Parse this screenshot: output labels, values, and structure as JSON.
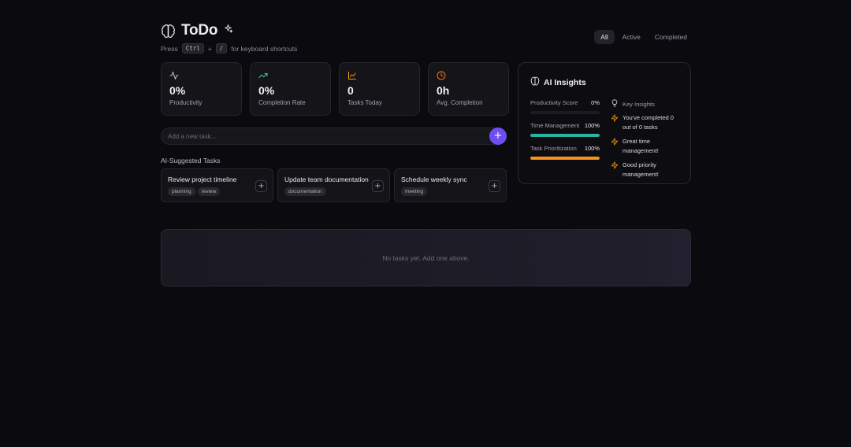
{
  "header": {
    "title": "ToDo",
    "press": "Press",
    "key1": "Ctrl",
    "plus": "+",
    "key2": "/",
    "hint": "for keyboard shortcuts"
  },
  "filters": [
    {
      "label": "All",
      "active": true
    },
    {
      "label": "Active",
      "active": false
    },
    {
      "label": "Completed",
      "active": false
    }
  ],
  "stats": [
    {
      "icon": "activity-icon",
      "value": "0%",
      "label": "Productivity",
      "color": "#c9c7d1"
    },
    {
      "icon": "trending-up-icon",
      "value": "0%",
      "label": "Completion Rate",
      "color": "#34d399"
    },
    {
      "icon": "line-chart-icon",
      "value": "0",
      "label": "Tasks Today",
      "color": "#f59e0b"
    },
    {
      "icon": "clock-icon",
      "value": "0h",
      "label": "Avg. Completion",
      "color": "#f97316"
    }
  ],
  "add_task": {
    "placeholder": "Add a new task...",
    "button": "+"
  },
  "suggestions": {
    "heading": "AI-Suggested Tasks",
    "items": [
      {
        "title": "Review project timeline",
        "tags": [
          "planning",
          "review"
        ]
      },
      {
        "title": "Update team documentation",
        "tags": [
          "documentation"
        ]
      },
      {
        "title": "Schedule weekly sync",
        "tags": [
          "meeting"
        ]
      }
    ],
    "add_label": "+"
  },
  "insights": {
    "title": "AI Insights",
    "metrics": [
      {
        "label": "Productivity Score",
        "value": "0%",
        "fraction": 0,
        "color": "#8b5cf6"
      },
      {
        "label": "Time Management",
        "value": "100%",
        "fraction": 1,
        "color": "#2ab3a0"
      },
      {
        "label": "Task Prioritization",
        "value": "100%",
        "fraction": 1,
        "color": "#f7941d"
      }
    ],
    "key_title": "Key Insights",
    "key_items": [
      "You've completed 0 out of 0 tasks",
      "Great time management!",
      "Good priority management!"
    ],
    "bolt_color": "#f59e0b"
  },
  "empty_state": "No tasks yet. Add one above."
}
